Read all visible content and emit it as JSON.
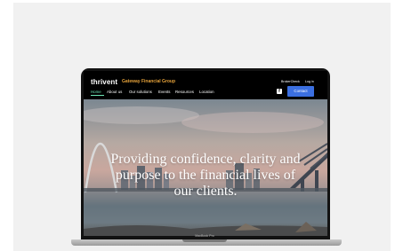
{
  "brand": {
    "logo_text": "thrivent",
    "group_name": "Gateway Financial Group"
  },
  "utility_links": [
    "BrokerCheck",
    "Log in"
  ],
  "nav": {
    "items": [
      "Home",
      "About us",
      "Our solutions",
      "Events",
      "Resources",
      "Location"
    ],
    "active": "Home"
  },
  "contact_button": "Contact",
  "hero": {
    "headline_line1": "Providing confidence, clarity and",
    "headline_line2": "purpose to the financial lives of",
    "headline_line3": "our clients."
  },
  "device": {
    "model_label": "MacBook Pro"
  },
  "colors": {
    "accent_green": "#6ee7b7",
    "contact_blue": "#3b6fe0",
    "group_gold": "#e4a13a",
    "panel_bg": "#f1f1f1"
  },
  "icons": [
    "facebook-icon"
  ]
}
